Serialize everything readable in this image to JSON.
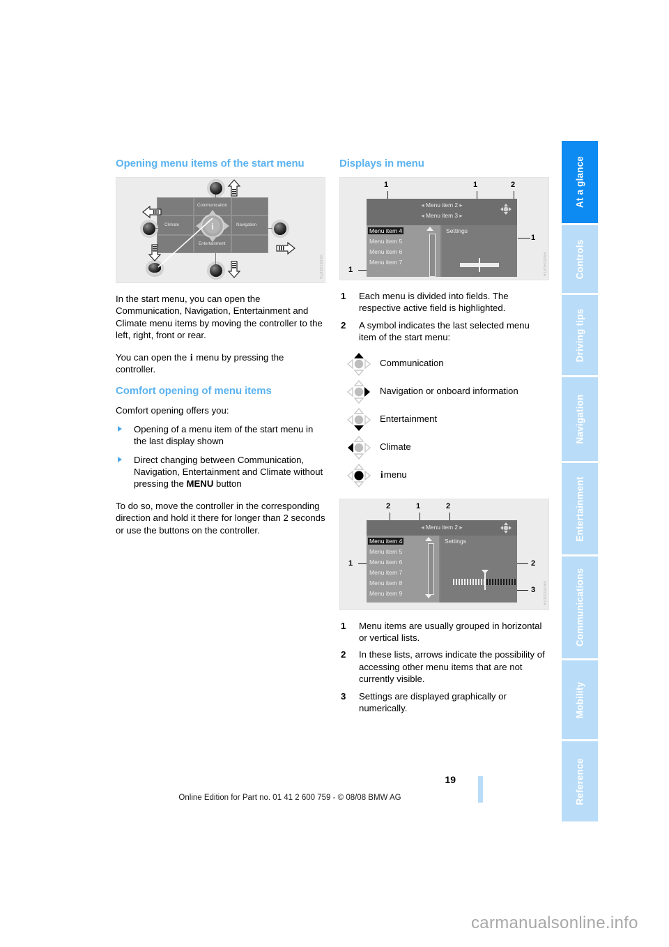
{
  "document": {
    "page_number": "19",
    "footer_note": "Online Edition for Part no. 01 41 2 600 759 - © 08/08 BMW AG",
    "watermark": "carmanualsonline.info"
  },
  "sidebar": {
    "tabs": [
      {
        "label": "At a glance",
        "active": true
      },
      {
        "label": "Controls",
        "active": false
      },
      {
        "label": "Driving tips",
        "active": false
      },
      {
        "label": "Navigation",
        "active": false
      },
      {
        "label": "Entertainment",
        "active": false
      },
      {
        "label": "Communications",
        "active": false
      },
      {
        "label": "Mobility",
        "active": false
      },
      {
        "label": "Reference",
        "active": false
      }
    ],
    "active_color": "#0d8bf2",
    "inactive_color": "#b9dcf8"
  },
  "left_column": {
    "heading_1": "Opening menu items of the start menu",
    "figure_start_menu": {
      "code": "VA081300TA",
      "center_label": "i",
      "cells": [
        {
          "label": "Communication"
        },
        {
          "label": "Climate"
        },
        {
          "label": "Navigation"
        },
        {
          "label": "Entertainment"
        }
      ]
    },
    "paragraph_1": "In the start menu, you can open the Communication, Navigation, Entertainment and Climate menu items by moving the controller to the left, right, front or rear.",
    "paragraph_2_pre": "You can open the",
    "paragraph_2_sym": "i",
    "paragraph_2_post": "menu by pressing the controller.",
    "heading_2": "Comfort opening of menu items",
    "paragraph_3": "Comfort opening offers you:",
    "bullets": [
      {
        "text": "Opening of a menu item of the start menu in the last display shown"
      },
      {
        "pre": "Direct changing between Communication, Navigation, Entertainment and Climate without pressing the ",
        "bold": "MENU",
        "post": " button"
      }
    ],
    "paragraph_4": "To do so, move the controller in the corresponding direction and hold it there for longer than 2 seconds or use the buttons on the controller."
  },
  "right_column": {
    "heading_1": "Displays in menu",
    "figure_display_1": {
      "code": "VA081400TA",
      "top_rows": [
        "Menu item 2",
        "Menu item 3"
      ],
      "settings_label": "Settings",
      "list_items": [
        "Menu item 4",
        "Menu item 5",
        "Menu item 6",
        "Menu item 7"
      ],
      "highlighted_item": "Menu item 4",
      "callouts": [
        "1",
        "1",
        "2",
        "1",
        "1"
      ]
    },
    "legend_1": [
      {
        "num": "1",
        "text": "Each menu is divided into fields. The respective active field is highlighted."
      },
      {
        "num": "2",
        "text": "A symbol indicates the last selected menu item of the start menu:"
      }
    ],
    "symbol_key": [
      {
        "icon": "controller-up-icon",
        "direction": "up",
        "label": "Communication"
      },
      {
        "icon": "controller-right-icon",
        "direction": "right",
        "label": "Navigation or onboard information"
      },
      {
        "icon": "controller-down-icon",
        "direction": "down",
        "label": "Entertainment"
      },
      {
        "icon": "controller-left-icon",
        "direction": "left",
        "label": "Climate"
      },
      {
        "icon": "controller-press-icon",
        "direction": "press",
        "label_sym": "i",
        "label": "menu"
      }
    ],
    "figure_display_2": {
      "code": "VA081500TA",
      "top_row": "Menu item 2",
      "settings_label": "Settings",
      "list_items": [
        "Menu item 4",
        "Menu item 5",
        "Menu item 6",
        "Menu item 7",
        "Menu item 8",
        "Menu item 9"
      ],
      "highlighted_item": "Menu item 4",
      "callouts": [
        "2",
        "1",
        "2",
        "1",
        "2",
        "3"
      ]
    },
    "legend_2": [
      {
        "num": "1",
        "text": "Menu items are usually grouped in horizontal or vertical lists."
      },
      {
        "num": "2",
        "text": "In these lists, arrows indicate the possibility of accessing other menu items that are not currently visible."
      },
      {
        "num": "3",
        "text": "Settings are displayed graphically or numerically."
      }
    ]
  }
}
